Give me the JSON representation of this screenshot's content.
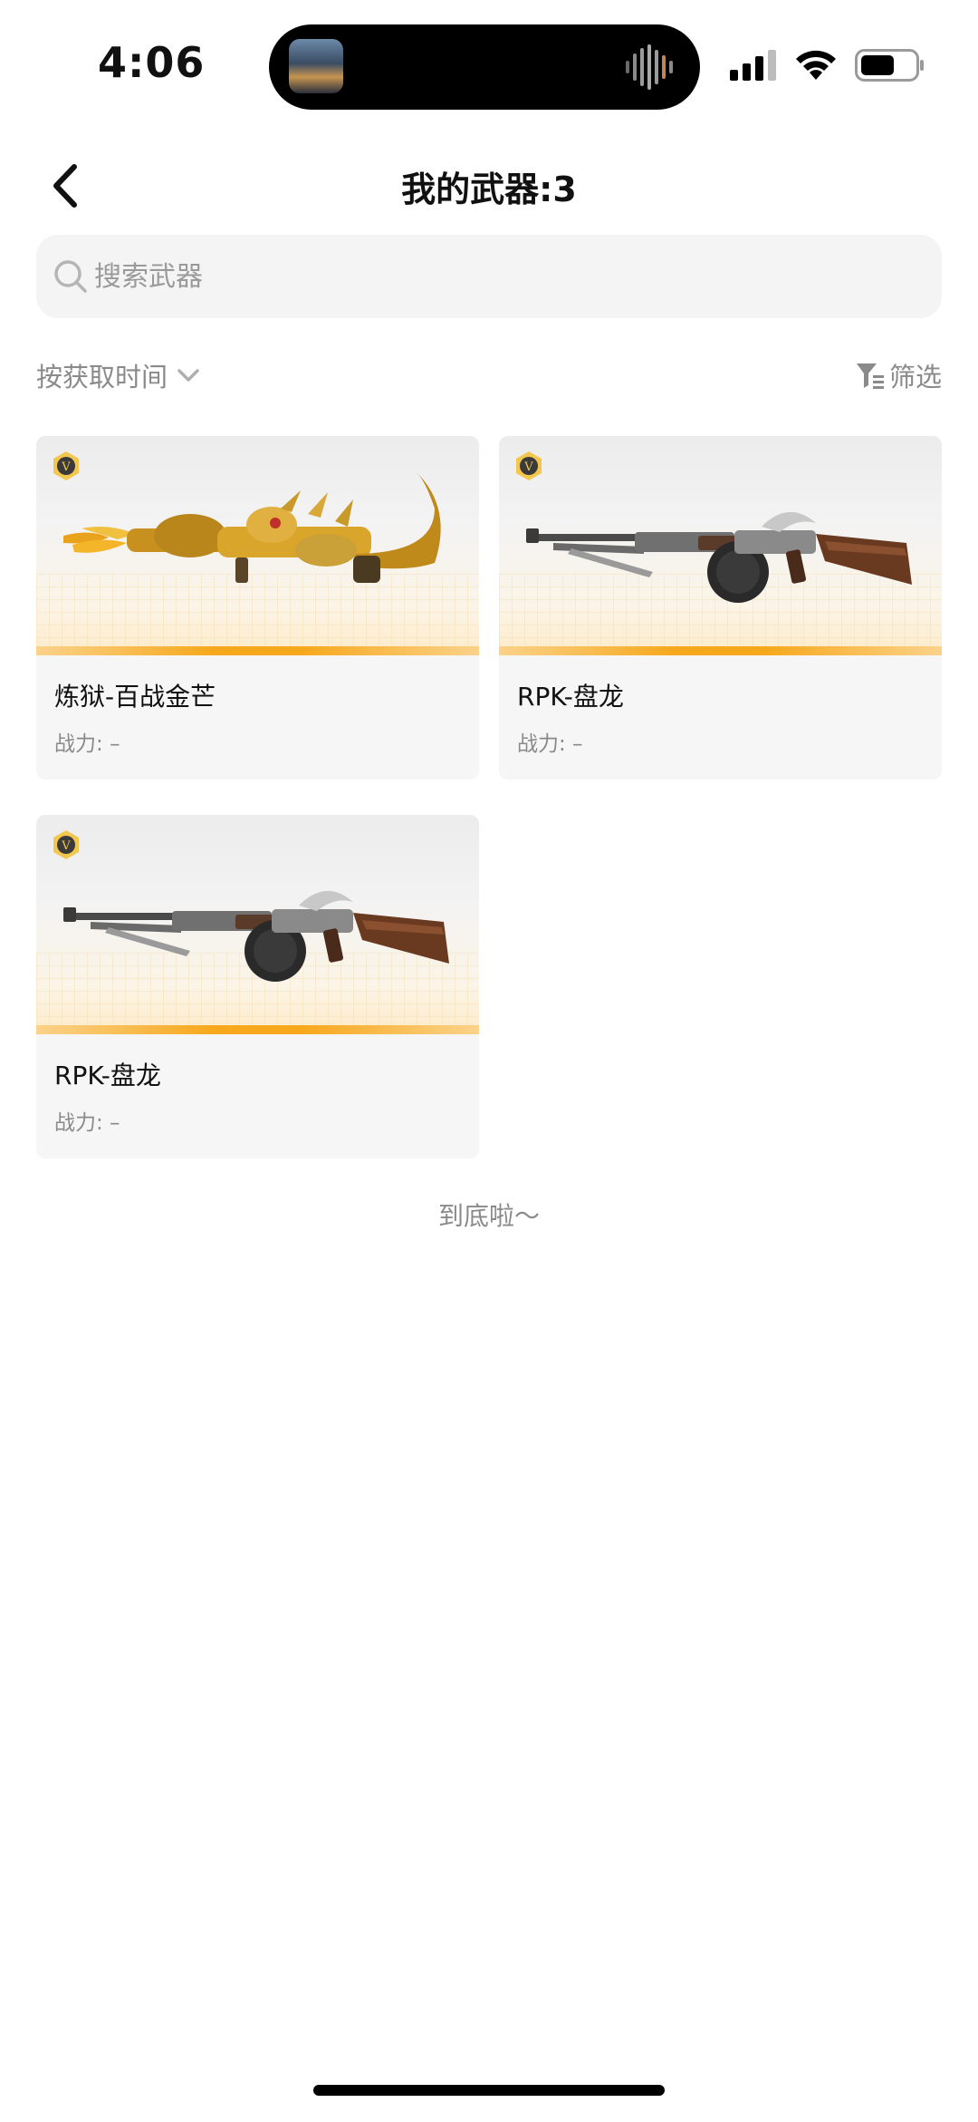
{
  "status_bar": {
    "time": "4:06"
  },
  "header": {
    "title": "我的武器:3"
  },
  "search": {
    "placeholder": "搜索武器"
  },
  "toolbar": {
    "sort_label": "按获取时间",
    "filter_label": "筛选"
  },
  "weapons": [
    {
      "name": "炼狱-百战金芒",
      "power": "战力: –",
      "skin": "gold"
    },
    {
      "name": "RPK-盘龙",
      "power": "战力: –",
      "skin": "steel"
    },
    {
      "name": "RPK-盘龙",
      "power": "战力: –",
      "skin": "steel"
    }
  ],
  "footer": {
    "end_text": "到底啦～"
  },
  "colors": {
    "accent_bar": "#f7a81c",
    "card_bg": "#f6f6f6",
    "muted_text": "#8a8a8a"
  }
}
